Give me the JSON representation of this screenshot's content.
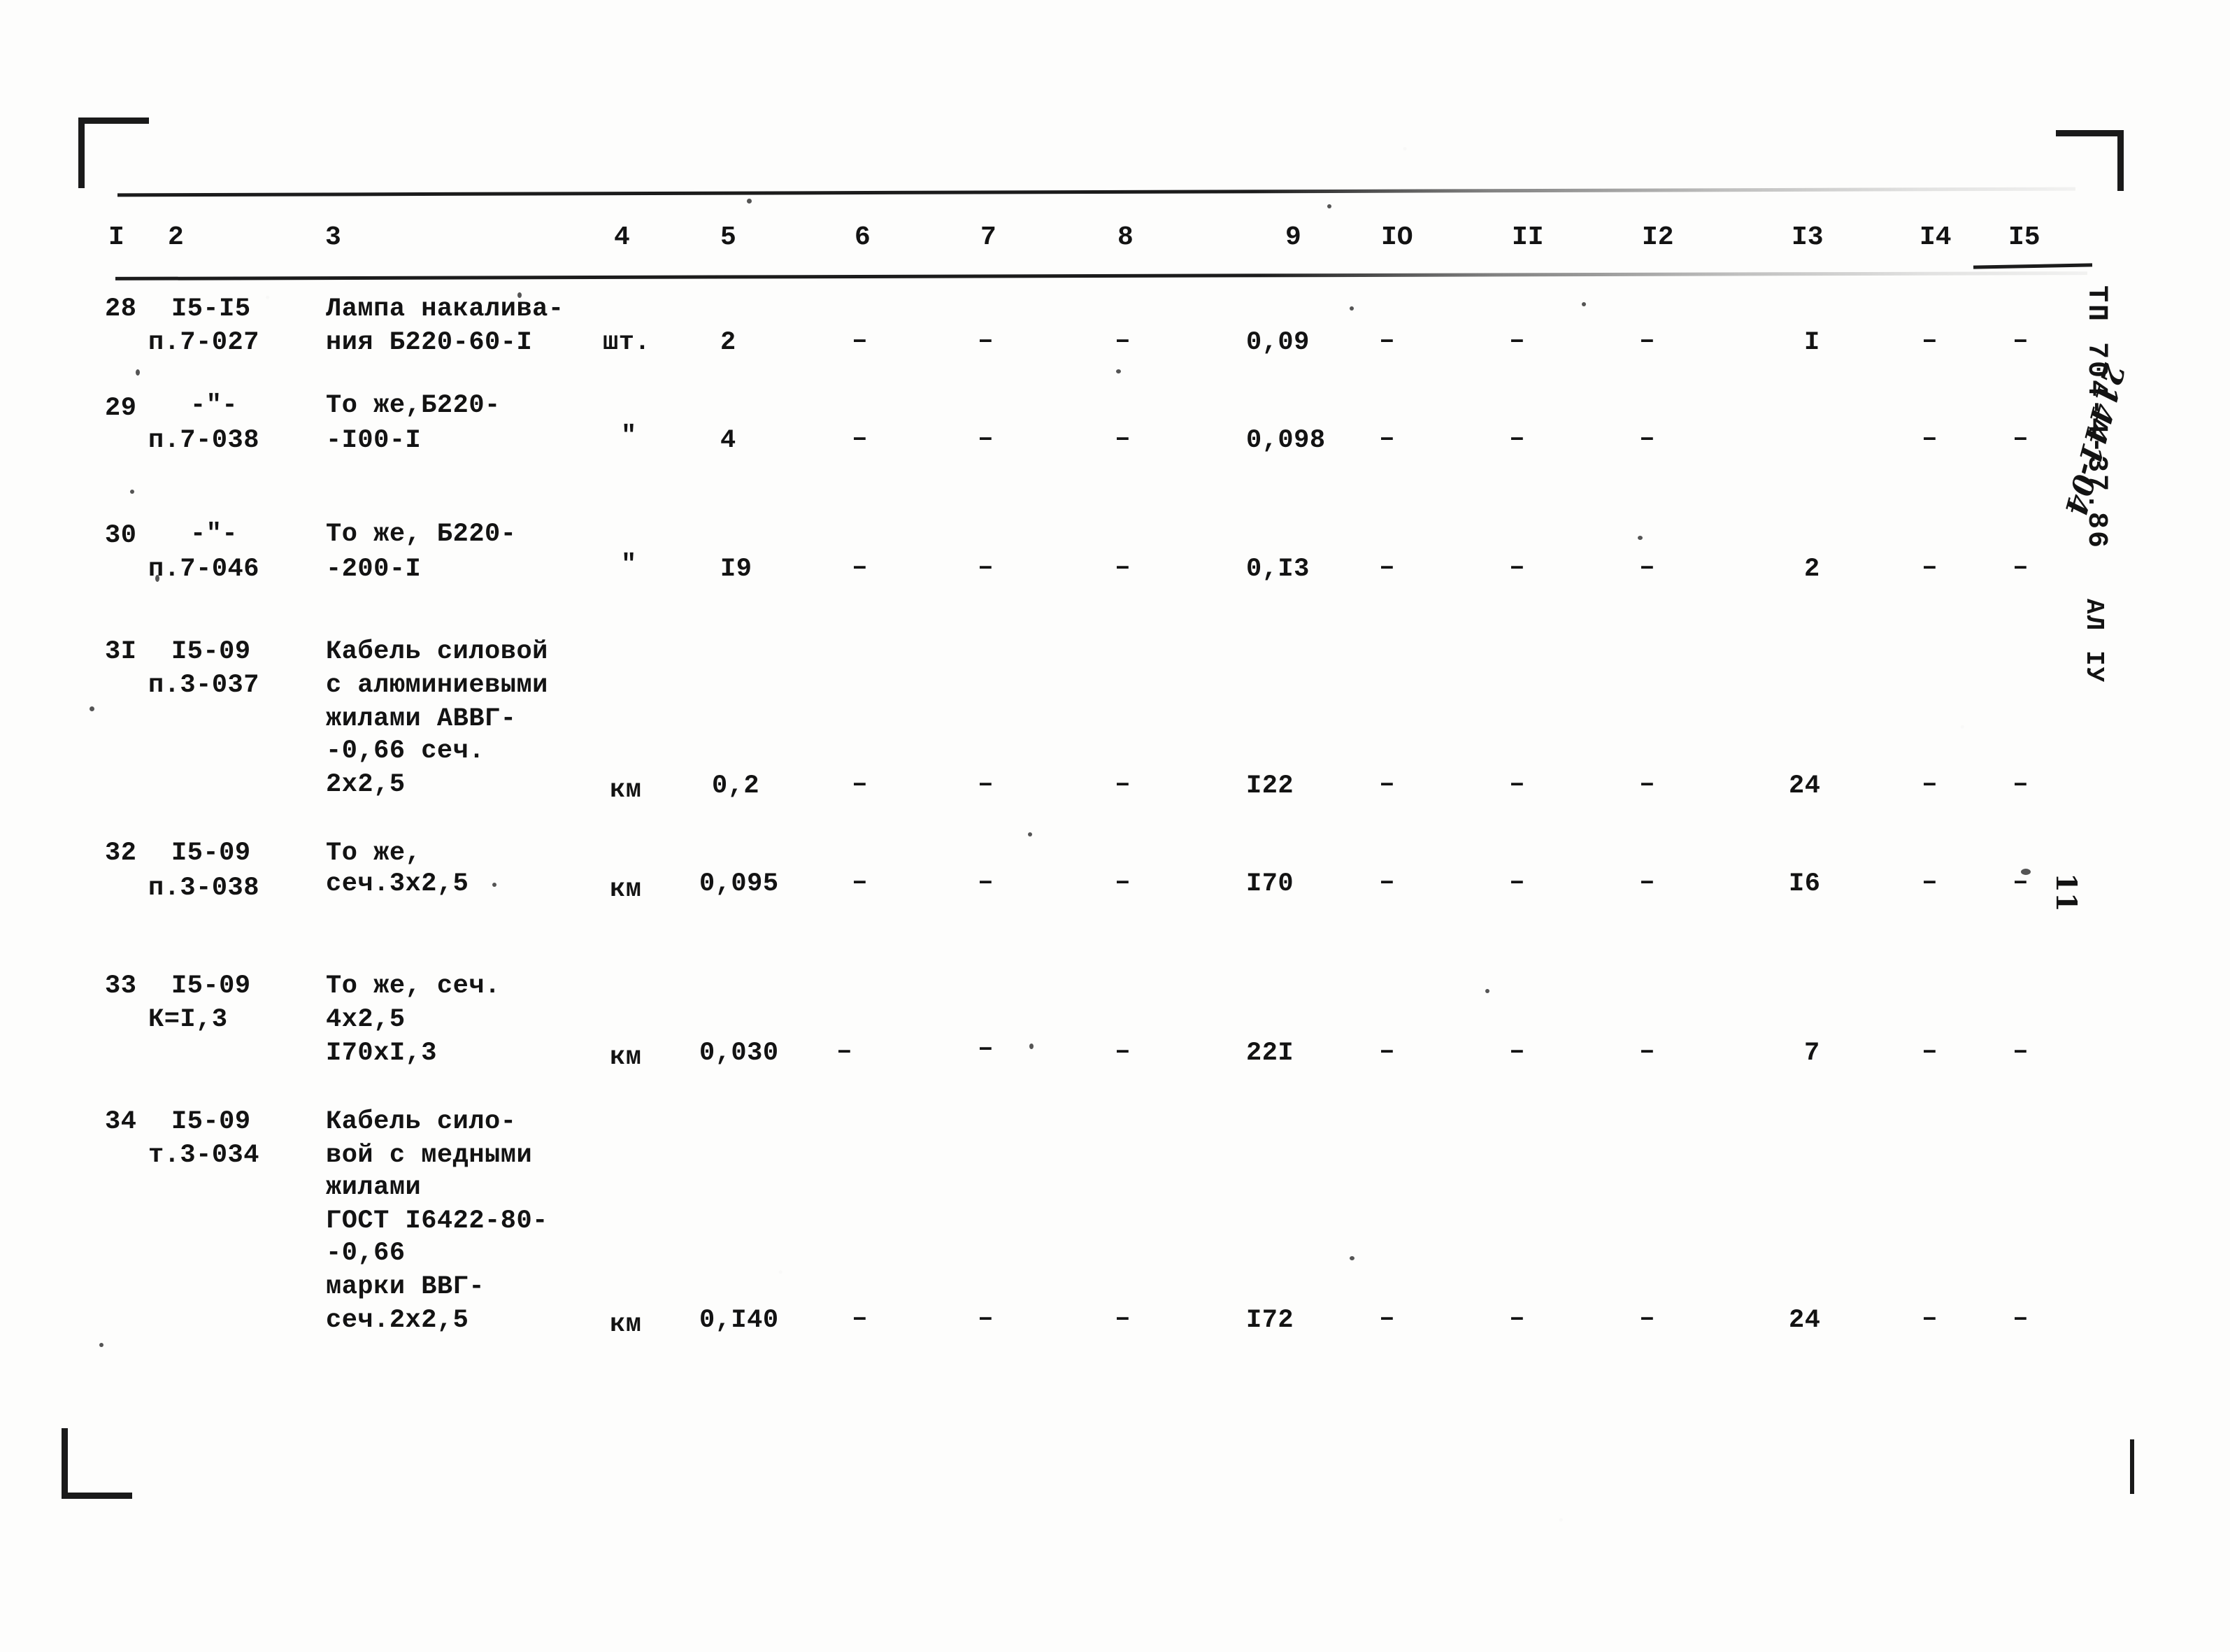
{
  "document": {
    "stamp_series": "ТП 704-4-37.86",
    "stamp_album": "АЛ",
    "stamp_album_part": "IУ",
    "handwritten_code": "21441-04",
    "page_number": "11"
  },
  "table": {
    "column_headers": [
      "I",
      "2",
      "3",
      "4",
      "5",
      "6",
      "7",
      "8",
      "9",
      "IO",
      "II",
      "I2",
      "I3",
      "I4",
      "I5"
    ],
    "empty_mark": "–",
    "rows": [
      {
        "num": "28",
        "code_lines": [
          "I5-I5",
          "п.7-027"
        ],
        "desc_lines": [
          "Лампа накалива-",
          "ния Б220-60-I"
        ],
        "unit": "шт.",
        "c5": "2",
        "c6": "–",
        "c7": "–",
        "c8": "–",
        "c9": "0,09",
        "c10": "–",
        "c11": "–",
        "c12": "–",
        "c13": "I",
        "c14": "–",
        "c15": "–"
      },
      {
        "num": "29",
        "code_lines": [
          "-\"-",
          "п.7-038"
        ],
        "desc_lines": [
          "То же,Б220-",
          "-I00-I"
        ],
        "unit": "\"",
        "c5": "4",
        "c6": "–",
        "c7": "–",
        "c8": "–",
        "c9": "0,098",
        "c10": "–",
        "c11": "–",
        "c12": "–",
        "c13": "",
        "c14": "–",
        "c15": "–"
      },
      {
        "num": "30",
        "code_lines": [
          "-\"-",
          "п.7-046"
        ],
        "desc_lines": [
          "То же, Б220-",
          "-200-I"
        ],
        "unit": "\"",
        "c5": "I9",
        "c6": "–",
        "c7": "–",
        "c8": "–",
        "c9": "0,I3",
        "c10": "–",
        "c11": "–",
        "c12": "–",
        "c13": "2",
        "c14": "–",
        "c15": "–"
      },
      {
        "num": "3I",
        "code_lines": [
          "I5-09",
          "п.3-037"
        ],
        "desc_lines": [
          "Кабель силовой",
          "с алюминиевыми",
          "жилами АВВГ-",
          "-0,66 сеч.",
          "2х2,5"
        ],
        "unit": "км",
        "c5": "0,2",
        "c6": "–",
        "c7": "–",
        "c8": "–",
        "c9": "I22",
        "c10": "–",
        "c11": "–",
        "c12": "–",
        "c13": "24",
        "c14": "–",
        "c15": "–"
      },
      {
        "num": "32",
        "code_lines": [
          "I5-09",
          "п.3-038"
        ],
        "desc_lines": [
          "То же,",
          "сеч.3х2,5"
        ],
        "unit": "км",
        "c5": "0,095",
        "c6": "–",
        "c7": "–",
        "c8": "–",
        "c9": "I70",
        "c10": "–",
        "c11": "–",
        "c12": "–",
        "c13": "I6",
        "c14": "–",
        "c15": "–"
      },
      {
        "num": "33",
        "code_lines": [
          "I5-09",
          "К=I,3"
        ],
        "desc_lines": [
          "То же, сеч.",
          "4х2,5",
          "I70хI,3"
        ],
        "unit": "км",
        "c5": "0,030",
        "c6": "–",
        "c7": "–",
        "c8": "–",
        "c9": "22I",
        "c10": "–",
        "c11": "–",
        "c12": "–",
        "c13": "7",
        "c14": "–",
        "c15": "–"
      },
      {
        "num": "34",
        "code_lines": [
          "I5-09",
          "т.3-034"
        ],
        "desc_lines": [
          "Кабель сило-",
          "вой с медными",
          "жилами",
          "ГОСТ I6422-80-",
          "-0,66",
          "марки ВВГ-",
          "сеч.2х2,5"
        ],
        "unit": "км",
        "c5": "0,I40",
        "c6": "–",
        "c7": "–",
        "c8": "–",
        "c9": "I72",
        "c10": "–",
        "c11": "–",
        "c12": "–",
        "c13": "24",
        "c14": "–",
        "c15": "–"
      }
    ]
  }
}
